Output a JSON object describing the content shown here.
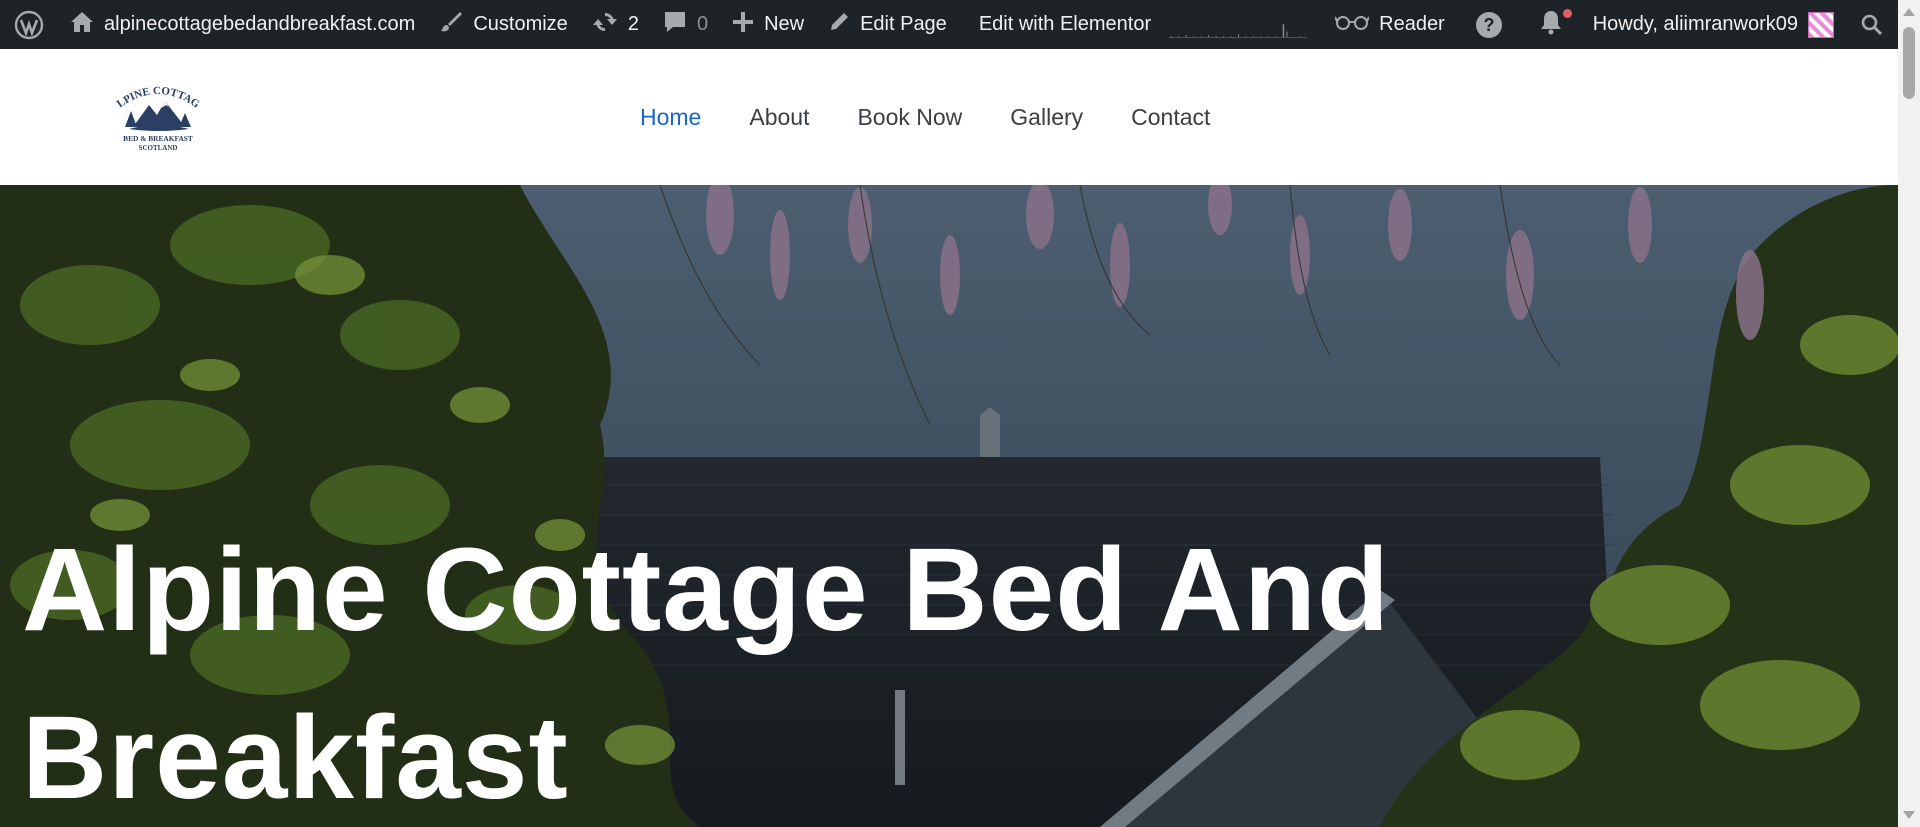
{
  "admin_bar": {
    "site_name": "alpinecottagebedandbreakfast.com",
    "customize": "Customize",
    "updates_count": "2",
    "comments_count": "0",
    "new_label": "New",
    "edit_page": "Edit Page",
    "edit_with_elementor": "Edit with Elementor",
    "reader": "Reader",
    "howdy": "Howdy, aliimranwork09",
    "icons": [
      "wordpress-logo-icon",
      "home-icon",
      "brush-icon",
      "refresh-icon",
      "comment-icon",
      "plus-icon",
      "pencil-icon",
      "glasses-icon",
      "help-icon",
      "bell-icon",
      "search-icon"
    ]
  },
  "header": {
    "logo_alt": "Alpine Cottage Bed & Breakfast Scotland",
    "logo_lines": [
      "ALPINE COTTAGE",
      "BED & BREAKFAST",
      "SCOTLAND"
    ],
    "nav": [
      {
        "label": "Home",
        "active": true
      },
      {
        "label": "About",
        "active": false
      },
      {
        "label": "Book Now",
        "active": false
      },
      {
        "label": "Gallery",
        "active": false
      },
      {
        "label": "Contact",
        "active": false
      }
    ]
  },
  "hero": {
    "title_line1": "Alpine Cottage Bed And",
    "title_line2": "Breakfast"
  },
  "colors": {
    "admin_bar_bg": "#1d2327",
    "nav_active": "#1a66c8",
    "nav_text": "#3a3f45",
    "logo_navy": "#2b3f63"
  }
}
